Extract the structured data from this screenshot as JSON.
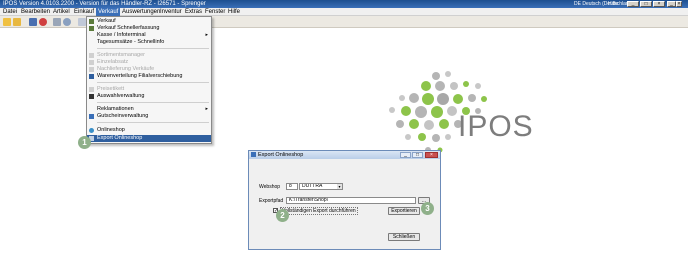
{
  "window": {
    "title": "IPOS  Version 4.0103.2200  -  Version für das Händler-RZ - I26571 - Sprenger",
    "locale": "DE Deutsch (Deutschland)",
    "help": "Hilfe",
    "controls": [
      "_",
      "□",
      "×",
      "_",
      "□",
      "×"
    ]
  },
  "menubar": {
    "items": [
      "Datei",
      "Bearbeiten",
      "Artikel",
      "Einkauf",
      "Verkauf",
      "Auswertungen",
      "Inventur",
      "Extras",
      "Fenster",
      "Hilfe"
    ],
    "active_index": 4
  },
  "toolbar": {
    "icons": [
      "open-icon",
      "close-icon",
      "save-icon",
      "delete-icon",
      "print-icon",
      "search-icon",
      "filter-icon"
    ]
  },
  "verkauf_menu": {
    "items": [
      {
        "label": "Verkauf",
        "icon": "cart-icon",
        "enabled": true,
        "submenu": false
      },
      {
        "label": "Verkauf Schnellerfassung",
        "icon": "cart-icon",
        "enabled": true,
        "submenu": false
      },
      {
        "label": "Kasse / Infoterminal",
        "icon": "",
        "enabled": true,
        "submenu": true
      },
      {
        "label": "Tagesumsätze - Schnellinfo",
        "icon": "",
        "enabled": true,
        "submenu": false
      },
      {
        "separator": true
      },
      {
        "label": "Sortimentsmanager",
        "icon": "box-icon",
        "enabled": false,
        "submenu": false
      },
      {
        "label": "Einzelabsatz",
        "icon": "box-icon",
        "enabled": false,
        "submenu": false
      },
      {
        "label": "Nachlieferung Verkäufe",
        "icon": "truck-icon",
        "enabled": false,
        "submenu": false
      },
      {
        "label": "Warenverteilung Filialverschiebung",
        "icon": "transfer-icon",
        "enabled": true,
        "submenu": false
      },
      {
        "separator": true
      },
      {
        "label": "Preisetikett",
        "icon": "tag-icon",
        "enabled": false,
        "submenu": false
      },
      {
        "label": "Auswahlverwaltung",
        "icon": "list-icon",
        "enabled": true,
        "submenu": false
      },
      {
        "separator": true
      },
      {
        "label": "Reklamationen",
        "icon": "",
        "enabled": true,
        "submenu": true
      },
      {
        "label": "Gutscheinverwaltung",
        "icon": "voucher-icon",
        "enabled": true,
        "submenu": false
      },
      {
        "separator": true
      },
      {
        "label": "Onlineshop",
        "icon": "globe-icon",
        "enabled": true,
        "submenu": false
      },
      {
        "label": "Export Onlineshop",
        "icon": "export-icon",
        "enabled": true,
        "submenu": false,
        "highlighted": true
      }
    ],
    "submenu_arrow": "▸"
  },
  "markers": [
    "1",
    "2",
    "3"
  ],
  "logo": {
    "text": "IPOS"
  },
  "dialog": {
    "title": "Export Onlineshop",
    "webshop_label": "Webshop",
    "webshop_id": "8",
    "webshop_name": "DUTTRA",
    "path_label": "Exportpfad",
    "path_value": "K:\\Transfer\\Shop\\",
    "browse_label": "...",
    "full_export_label": "Vollständigen Export durchführen",
    "full_export_checked": true,
    "checkmark": "✓",
    "export_button": "Exportieren",
    "close_button": "Schließen",
    "dropdown_arrow": "▾"
  },
  "colors": {
    "accent": "#3a6fb8",
    "marker": "#8fb08a",
    "logo_green": "#8dc44a",
    "logo_gray": "#b5b5b5"
  }
}
